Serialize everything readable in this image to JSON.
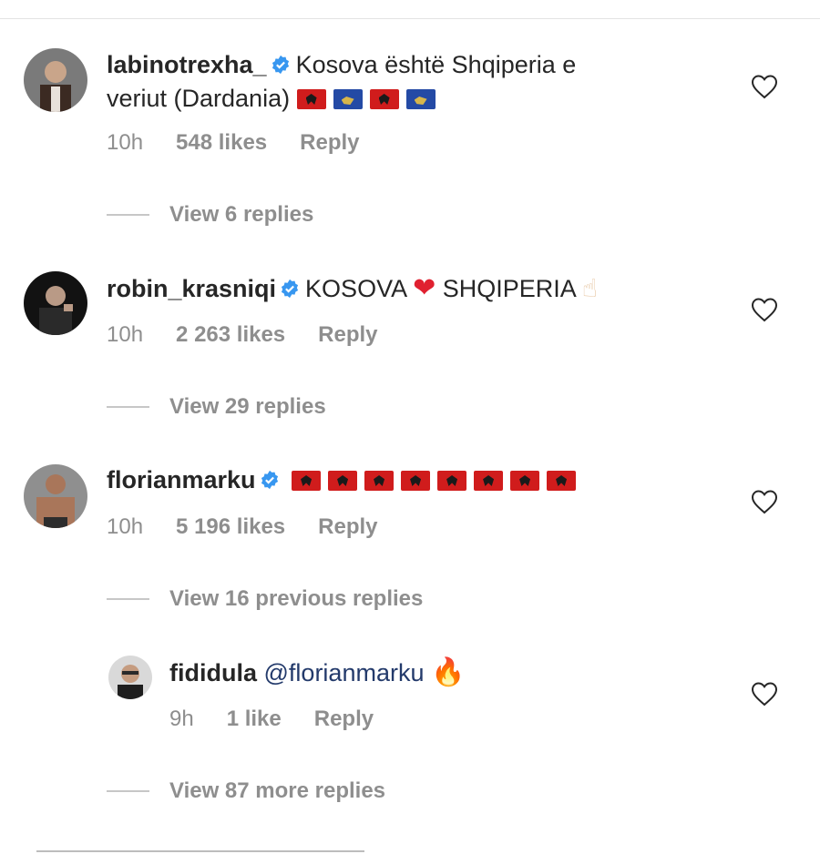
{
  "comments": [
    {
      "username": "labinotrexha_",
      "text_line1": "Kosova është Shqiperia e",
      "text_line2": "veriut (Dardania)",
      "flags": [
        "al",
        "ks",
        "al",
        "ks"
      ],
      "time": "10h",
      "likes": "548 likes",
      "reply": "Reply",
      "view_replies": "View 6 replies"
    },
    {
      "username": "robin_krasniqi",
      "text_a": "KOSOVA",
      "emoji_heart": "❤",
      "text_b": "SHQIPERIA",
      "emoji_finger": "☝",
      "time": "10h",
      "likes": "2 263 likes",
      "reply": "Reply",
      "view_replies": "View 29 replies"
    },
    {
      "username": "florianmarku",
      "flags": [
        "al",
        "al",
        "al",
        "al",
        "al",
        "al",
        "al",
        "al"
      ],
      "time": "10h",
      "likes": "5 196 likes",
      "reply": "Reply",
      "view_replies": "View 16 previous replies"
    },
    {
      "username": "fididula",
      "mention": "@florianmarku",
      "emoji_fire": "🔥",
      "time": "9h",
      "likes": "1 like",
      "reply": "Reply",
      "view_replies": "View 87 more replies"
    }
  ],
  "icons": {
    "verified": "verified-badge-icon",
    "heart": "heart-outline-icon"
  },
  "colors": {
    "verified": "#3897f0",
    "meta": "#8e8e8e",
    "mention": "#233a6b"
  }
}
